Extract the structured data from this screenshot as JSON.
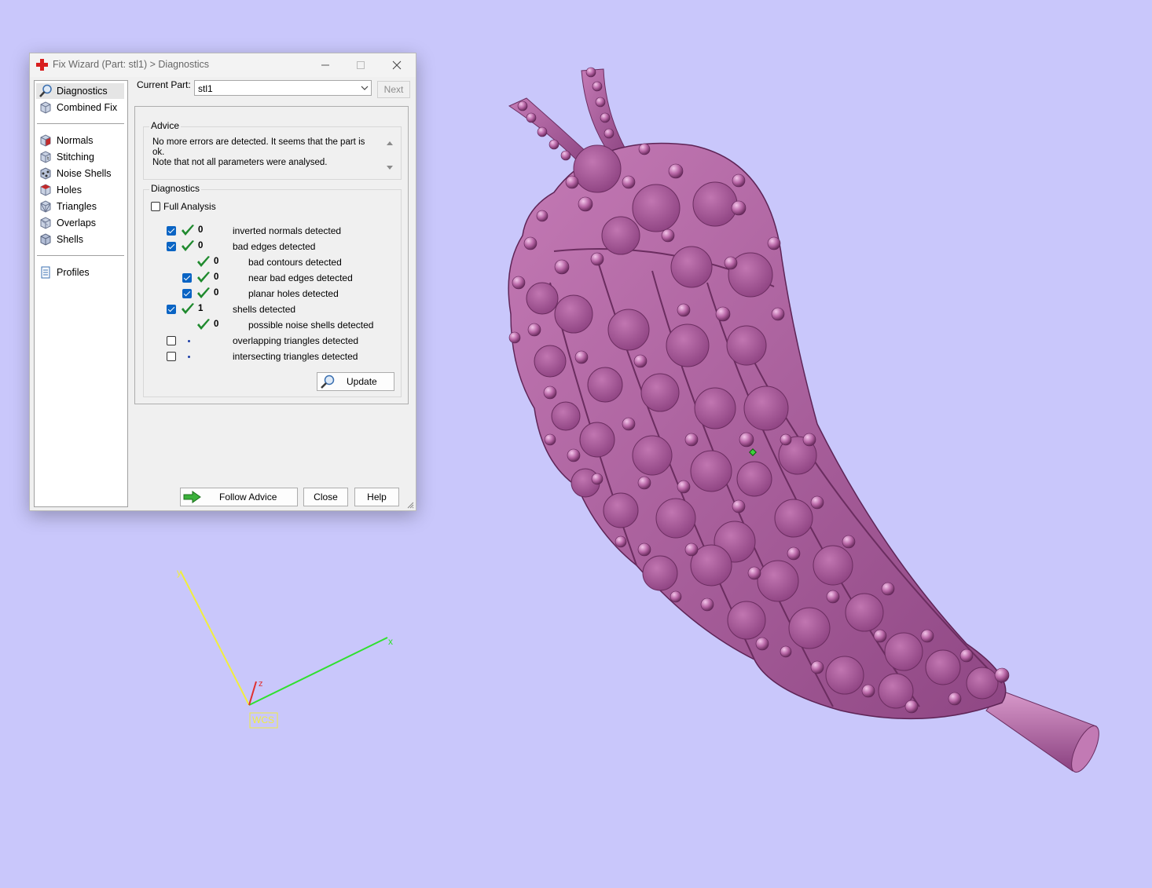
{
  "window": {
    "title": "Fix Wizard (Part: stl1) > Diagnostics",
    "controls": [
      "minimize-icon",
      "maximize-icon",
      "close-icon"
    ]
  },
  "sidebar": {
    "items": [
      {
        "label": "Diagnostics",
        "icon": "magnifier-icon",
        "selected": true
      },
      {
        "label": "Combined Fix",
        "icon": "cube-icon"
      },
      {
        "label": "Normals",
        "icon": "normals-cube-icon"
      },
      {
        "label": "Stitching",
        "icon": "stitching-cube-icon"
      },
      {
        "label": "Noise Shells",
        "icon": "noise-shells-icon"
      },
      {
        "label": "Holes",
        "icon": "holes-cube-icon"
      },
      {
        "label": "Triangles",
        "icon": "triangles-cube-icon"
      },
      {
        "label": "Overlaps",
        "icon": "overlaps-cube-icon"
      },
      {
        "label": "Shells",
        "icon": "shells-cube-icon"
      },
      {
        "label": "Profiles",
        "icon": "document-icon"
      }
    ]
  },
  "current_part": {
    "label": "Current Part:",
    "value": "stl1",
    "next_label": "Next"
  },
  "advice": {
    "title": "Advice",
    "text": "No more errors are detected. It seems that the part is ok.\nNote that not all parameters were analysed."
  },
  "diagnostics": {
    "title": "Diagnostics",
    "full_analysis_label": "Full Analysis",
    "full_analysis_checked": false,
    "rows": [
      {
        "checkbox": true,
        "checked": true,
        "status": "ok",
        "count": "0",
        "label": "inverted normals detected",
        "indent": 0
      },
      {
        "checkbox": true,
        "checked": true,
        "status": "ok",
        "count": "0",
        "label": "bad edges detected",
        "indent": 0
      },
      {
        "checkbox": false,
        "checked": false,
        "status": "ok",
        "count": "0",
        "label": "bad contours detected",
        "indent": 1
      },
      {
        "checkbox": true,
        "checked": true,
        "status": "ok",
        "count": "0",
        "label": "near bad edges detected",
        "indent": 1
      },
      {
        "checkbox": true,
        "checked": true,
        "status": "ok",
        "count": "0",
        "label": "planar holes detected",
        "indent": 1
      },
      {
        "checkbox": true,
        "checked": true,
        "status": "ok",
        "count": "1",
        "label": "shells detected",
        "indent": 0
      },
      {
        "checkbox": false,
        "checked": false,
        "status": "ok",
        "count": "0",
        "label": "possible noise shells detected",
        "indent": 1
      },
      {
        "checkbox": true,
        "checked": false,
        "status": "unknown",
        "count": "",
        "label": "overlapping triangles detected",
        "indent": 0
      },
      {
        "checkbox": true,
        "checked": false,
        "status": "unknown",
        "count": "",
        "label": "intersecting triangles detected",
        "indent": 0
      }
    ],
    "update_label": "Update"
  },
  "footer": {
    "follow_advice_label": "Follow Advice",
    "close_label": "Close",
    "help_label": "Help"
  },
  "axes": {
    "x_label": "x",
    "y_label": "y",
    "z_label": "z",
    "wcs_label": "WCS",
    "x_color": "#2fe02f",
    "y_color": "#f1ee3c",
    "z_color": "#e03030"
  },
  "colors": {
    "background": "#c9c7fb",
    "model": "#b86aa6",
    "selected_checkbox": "#0a64c4",
    "ok_tick": "#1f8a2e"
  }
}
